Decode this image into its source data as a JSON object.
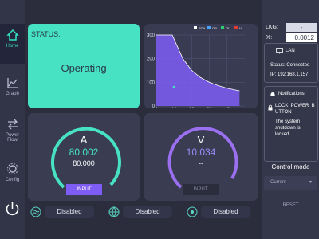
{
  "sidebar": {
    "items": [
      {
        "label": "Home"
      },
      {
        "label": "Graph"
      },
      {
        "label": "Power Flow"
      },
      {
        "label": "Config"
      }
    ]
  },
  "status": {
    "title": "STATUS:",
    "value": "Operating"
  },
  "chart_data": {
    "type": "line",
    "x_ticks": [
      "0",
      "10",
      "20",
      "30",
      "40"
    ],
    "y_ticks": [
      "300",
      "200",
      "100",
      "0"
    ],
    "xlim": [
      0,
      50
    ],
    "ylim": [
      0,
      300
    ],
    "legend": [
      "SOA",
      "OP",
      "OL",
      "VL"
    ],
    "legend_colors": [
      "#ffffff",
      "#4aa3ff",
      "#2ecc71",
      "#e53935"
    ],
    "series": [
      {
        "x": [
          0,
          9,
          12,
          15,
          20,
          25,
          30,
          35,
          40,
          45,
          47
        ],
        "y": [
          300,
          300,
          250,
          200,
          150,
          120,
          100,
          86,
          75,
          67,
          64
        ]
      }
    ],
    "points": [
      {
        "x": 10,
        "y": 80
      }
    ],
    "grid": true
  },
  "meters": {
    "current": {
      "letter": "A",
      "value": "80.002",
      "setpoint": "80.000",
      "button": "INPUT"
    },
    "voltage": {
      "letter": "V",
      "value": "10.034",
      "setpoint": "--",
      "button": "INPUT"
    }
  },
  "bottom": {
    "items": [
      {
        "label": "Disabled"
      },
      {
        "label": "Disabled"
      },
      {
        "label": "Disabled"
      }
    ]
  },
  "right": {
    "lkg_label": "LKG:",
    "lkg_value": "-",
    "pct_label": "%:",
    "pct_value": "0.0012",
    "lan": {
      "label": "LAN",
      "status": "Status: Connected",
      "ip": "IP: 192.168.1.157"
    },
    "notifications": {
      "title": "Notifications",
      "name": "LOCK_POWER_BUTTON",
      "message": "The system shutdown is locked"
    },
    "control_mode": {
      "title": "Control mode",
      "value": "Current"
    },
    "reset_label": "RESET"
  }
}
